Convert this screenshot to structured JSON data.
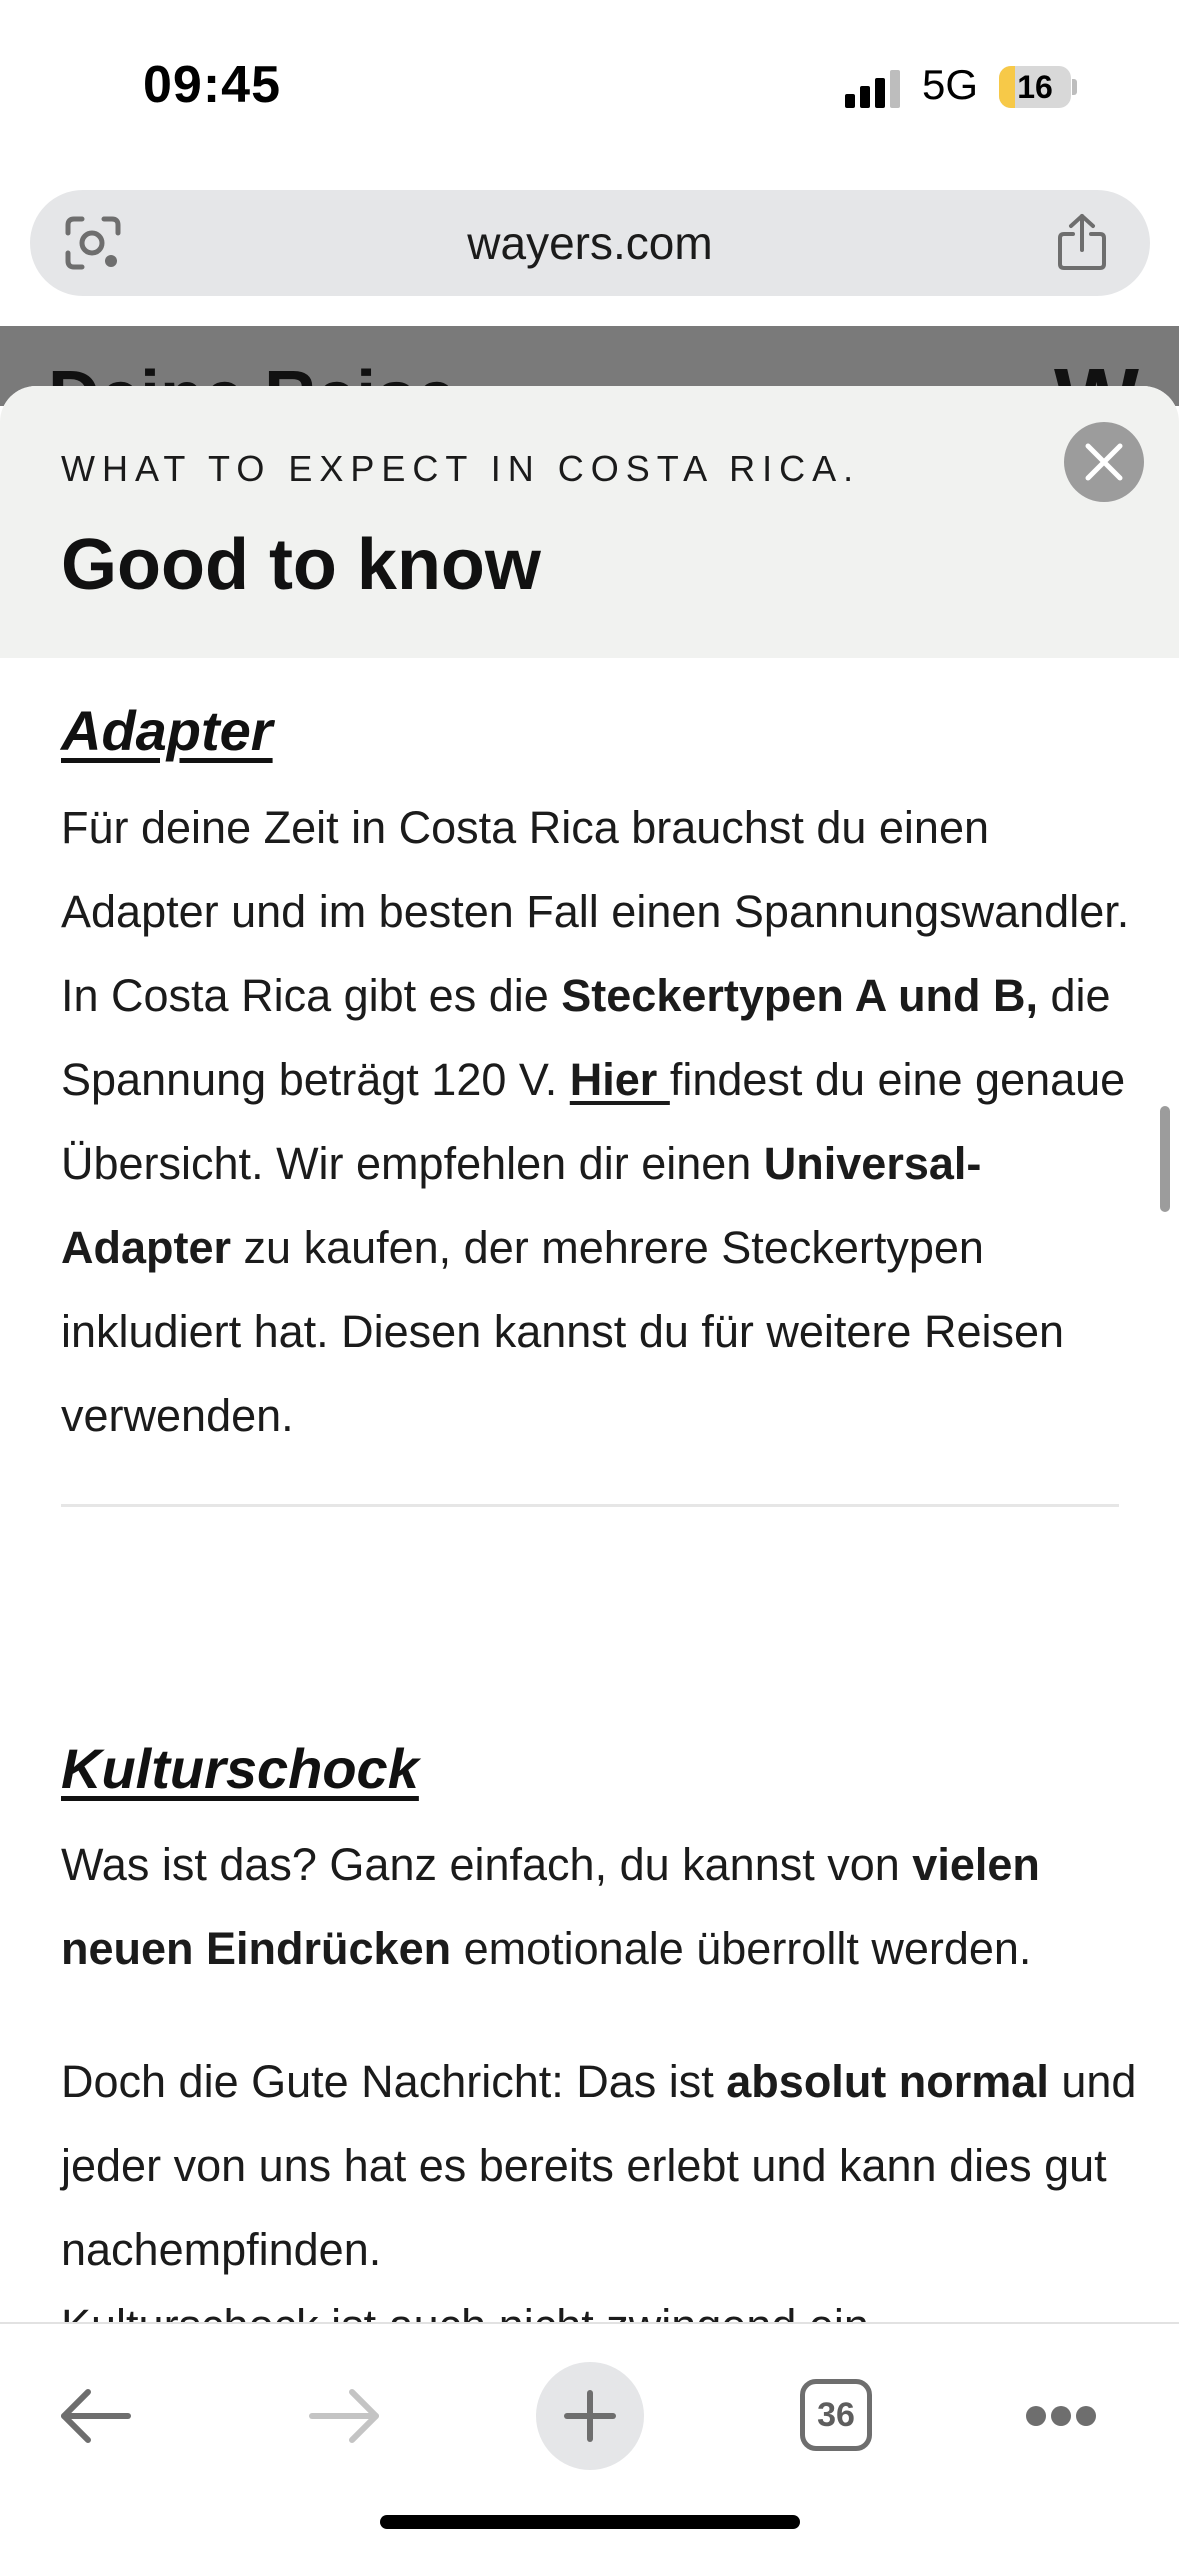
{
  "status_bar": {
    "time": "09:45",
    "network": "5G",
    "battery": "16",
    "battery_level": 0.16
  },
  "browser": {
    "url": "wayers.com",
    "icons": {
      "lens": "visual-search-icon",
      "share": "share-icon"
    }
  },
  "background_page": {
    "heading": "Deine Reise",
    "logo": "W"
  },
  "sheet": {
    "eyebrow": "WHAT TO EXPECT IN COSTA RICA.",
    "title": "Good to know",
    "close_icon": "close-icon",
    "sections": [
      {
        "title": "Adapter",
        "paragraphs": [
          {
            "t1": "Für deine Zeit in Costa Rica brauchst du einen Adapter und im besten Fall einen Spannungswandler. In Costa Rica gibt es die ",
            "b1": "Steckertypen A und B,",
            "t2": " die Spannung beträgt 120 V. ",
            "link": "Hier ",
            "t3": "findest du eine genaue Übersicht. Wir empfehlen dir einen ",
            "b2": "Universal-Adapter",
            "t4": " zu kaufen, der mehrere Steckertypen inkludiert hat. Diesen kannst du für weitere Reisen verwenden."
          }
        ]
      },
      {
        "title": "Kulturschock",
        "paragraphs": [
          {
            "t1": "Was ist das? Ganz einfach, du kannst von ",
            "b1": "vielen neuen Eindrücken",
            "t2": " emotionale überrollt werden."
          },
          {
            "t1": "Doch die Gute Nachricht: Das ist ",
            "b1": "absolut normal",
            "t2": " und jeder von uns hat es bereits erlebt und kann dies gut nachempfinden."
          }
        ],
        "cutoff_text": "Kulturschock ist auch nicht zwingend ein"
      }
    ]
  },
  "toolbar": {
    "tab_count": "36",
    "icons": [
      "back-arrow-icon",
      "forward-arrow-icon",
      "plus-icon",
      "tabs-icon",
      "more-icon"
    ]
  }
}
